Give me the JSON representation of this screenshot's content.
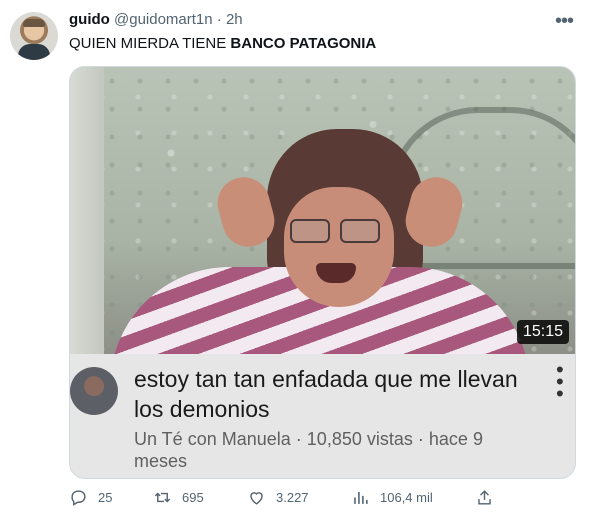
{
  "tweet": {
    "author_name": "guido",
    "author_handle": "@guidomart1n",
    "separator": "·",
    "time": "2h",
    "text_plain": "QUIEN MIERDA TIENE ",
    "text_bold": "BANCO PATAGONIA",
    "more_icon": "more-horizontal-icon"
  },
  "video_card": {
    "duration": "15:15",
    "title": "estoy tan tan enfadada que me llevan los demonios",
    "channel": "Un Té con Manuela",
    "views": "10,850 vistas",
    "age": "hace 9 meses",
    "meta_sep": "·",
    "menu_icon": "more-vertical-icon"
  },
  "actions": {
    "replies": "25",
    "retweets": "695",
    "likes": "3.227",
    "views": "106,4 mil",
    "icons": [
      "reply-icon",
      "retweet-icon",
      "like-icon",
      "views-icon",
      "share-icon"
    ]
  }
}
